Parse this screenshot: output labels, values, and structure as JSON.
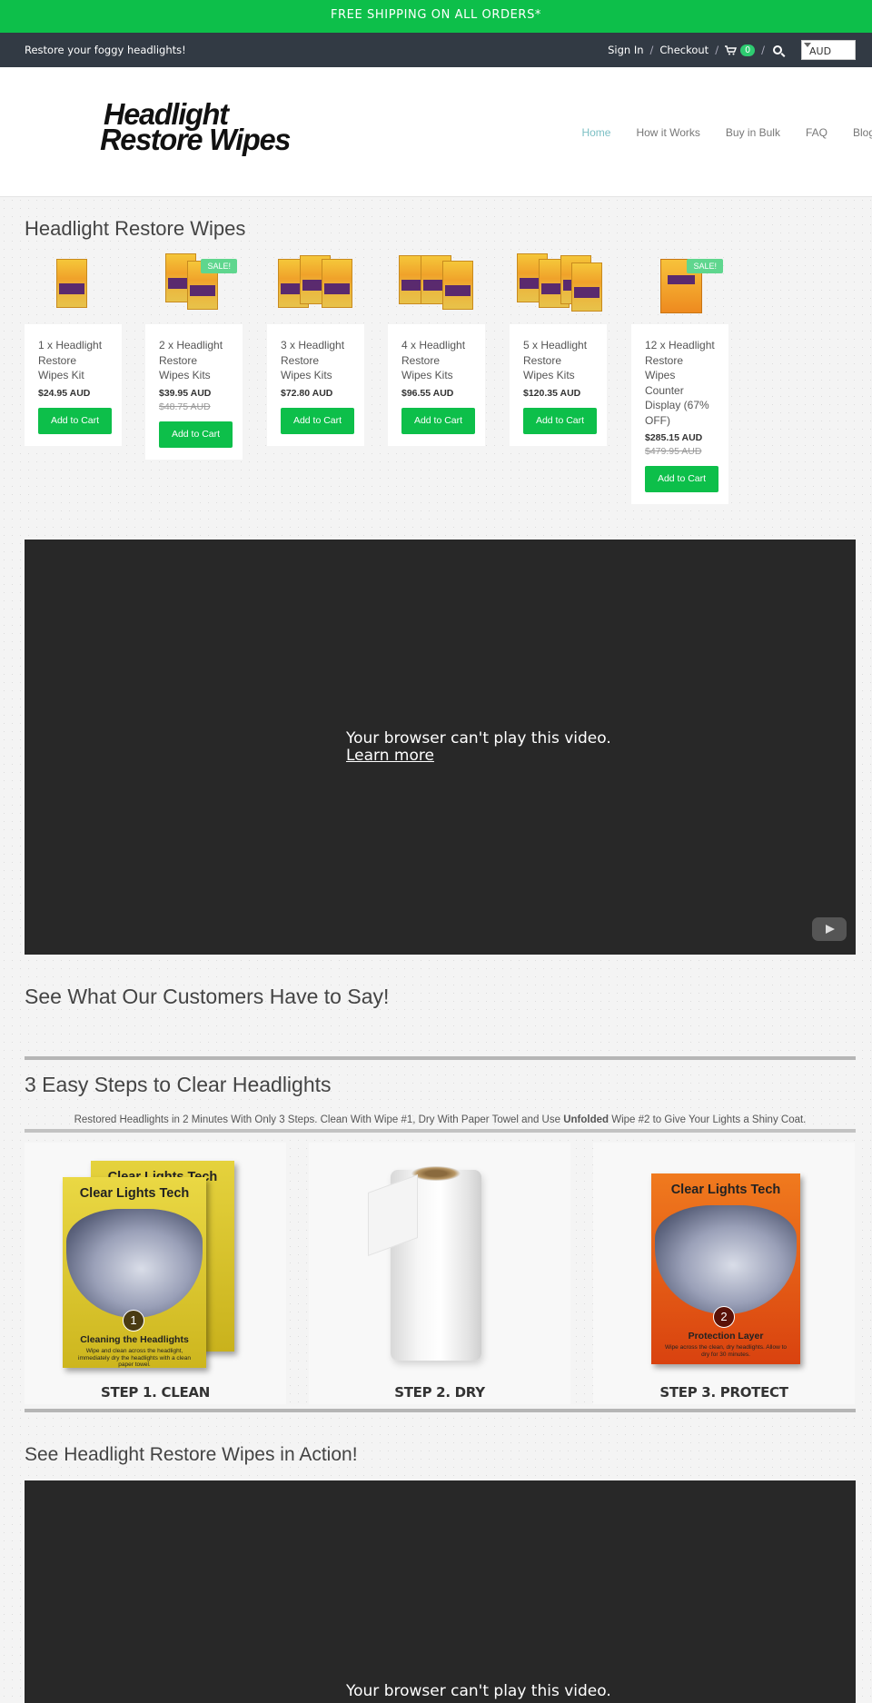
{
  "promo": {
    "text": "FREE SHIPPING ON ALL ORDERS*"
  },
  "topbar": {
    "tagline": "Restore your foggy headlights!",
    "sign_in": "Sign In",
    "checkout": "Checkout",
    "cart_count": "0",
    "currency": "AUD"
  },
  "header": {
    "logo_line1": "Headlight",
    "logo_line2": "Restore Wipes"
  },
  "nav": {
    "items": [
      "Home",
      "How it Works",
      "Buy in Bulk",
      "FAQ",
      "Blog"
    ]
  },
  "collection": {
    "title": "Headlight Restore Wipes",
    "products": [
      {
        "name": "1 x Headlight Restore Wipes Kit",
        "price": "$24.95 AUD",
        "was": "",
        "sale": "",
        "button": "Add to Cart"
      },
      {
        "name": "2 x Headlight Restore Wipes Kits",
        "price": "$39.95 AUD",
        "was": "$48.75 AUD",
        "sale": "SALE!",
        "button": "Add to Cart"
      },
      {
        "name": "3 x Headlight Restore Wipes Kits",
        "price": "$72.80 AUD",
        "was": "",
        "sale": "",
        "button": "Add to Cart"
      },
      {
        "name": "4 x Headlight Restore Wipes Kits",
        "price": "$96.55 AUD",
        "was": "",
        "sale": "",
        "button": "Add to Cart"
      },
      {
        "name": "5 x Headlight Restore Wipes Kits",
        "price": "$120.35 AUD",
        "was": "",
        "sale": "",
        "button": "Add to Cart"
      },
      {
        "name": "12 x Headlight Restore Wipes Counter Display (67% OFF)",
        "price": "$285.15 AUD",
        "was": "$479.95 AUD",
        "sale": "SALE!",
        "button": "Add to Cart"
      }
    ]
  },
  "video1": {
    "message": "Your browser can't play this video.",
    "link": "Learn more"
  },
  "testimonials": {
    "title": "See What Our Customers Have to Say!"
  },
  "steps": {
    "title": "3 Easy Steps to Clear Headlights",
    "description_before": "Restored Headlights in 2 Minutes With Only 3 Steps. Clean With Wipe #1, Dry With Paper Towel and Use ",
    "description_bold": "Unfolded",
    "description_after": " Wipe #2 to Give Your Lights a Shiny Coat.",
    "items": [
      {
        "caption": "STEP 1. CLEAN",
        "kit_title": "Clear Lights Tech",
        "kit_num": "1",
        "kit_sub": "Cleaning the Headlights",
        "kit_desc": "Wipe and clean across the headlight, immediately dry the headlights with a clean paper towel.",
        "back_title": "Clear Lights Tech"
      },
      {
        "caption": "STEP 2. DRY"
      },
      {
        "caption": "STEP 3. PROTECT",
        "kit_title": "Clear Lights Tech",
        "kit_num": "2",
        "kit_sub": "Protection Layer",
        "kit_desc": "Wipe across the clean, dry headlights. Allow to dry for 30 minutes."
      }
    ]
  },
  "action": {
    "title": "See Headlight Restore Wipes in Action!",
    "message": "Your browser can't play this video."
  },
  "colors": {
    "accent": "#0dbf4a",
    "topbar": "#323a44",
    "nav_active": "#7bbfc4",
    "video_bg": "#282828"
  }
}
